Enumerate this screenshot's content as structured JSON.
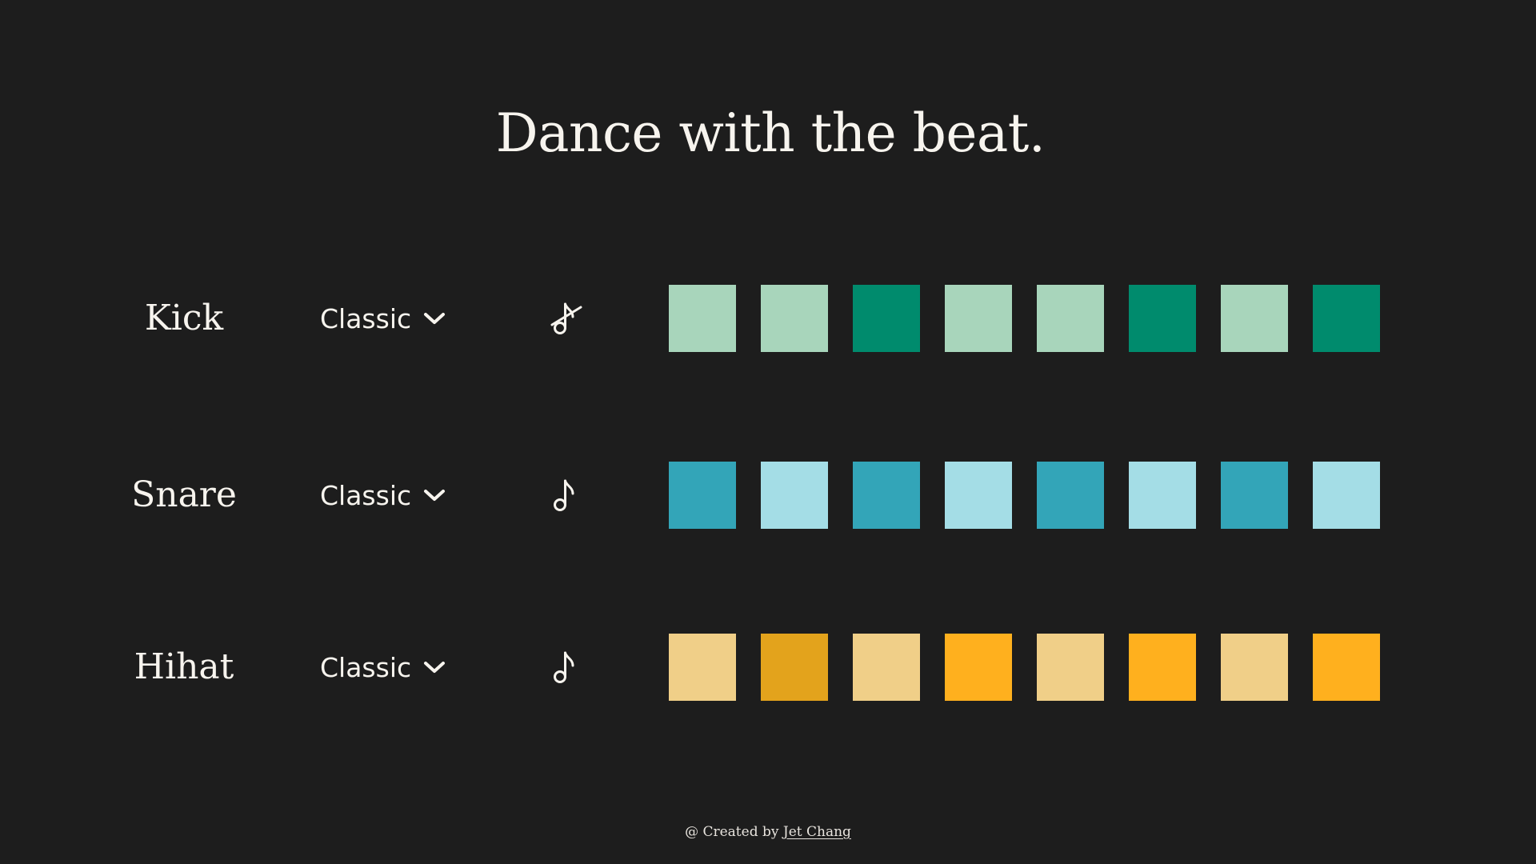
{
  "title": "Dance with the beat.",
  "tracks": [
    {
      "name": "Kick",
      "sound": "Classic",
      "muted": true,
      "steps": [
        false,
        false,
        true,
        false,
        false,
        true,
        false,
        true
      ],
      "color_off": "#a8d5bb",
      "color_on": "#008b6d"
    },
    {
      "name": "Snare",
      "sound": "Classic",
      "muted": false,
      "steps": [
        true,
        false,
        true,
        false,
        true,
        false,
        true,
        false
      ],
      "color_off": "#a4dde6",
      "color_on": "#33a5b8"
    },
    {
      "name": "Hihat",
      "sound": "Classic",
      "muted": false,
      "steps": [
        false,
        true,
        false,
        true,
        false,
        true,
        false,
        true
      ],
      "color_off": "#f0cf88",
      "colors_on": [
        "#e3a31c",
        "#ffb01e",
        "#ffb01e",
        "#ffb01e"
      ]
    }
  ],
  "icons": {
    "dropdown": "chevron-down-icon",
    "note": "music-note-icon",
    "note_muted": "music-note-muted-icon"
  },
  "footer": {
    "prefix": "@ Created by ",
    "author": "Jet Chang"
  },
  "colors": {
    "background": "#1d1d1d",
    "text": "#f7f4ee"
  }
}
